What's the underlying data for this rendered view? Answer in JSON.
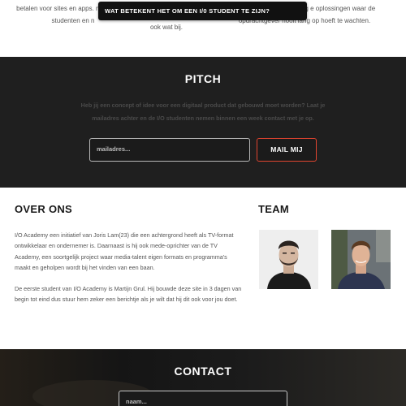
{
  "top": {
    "col1": "betalen voor sites en apps. maken voor studenten en n",
    "col2": "ook wat bij.",
    "col3": "er het product. Het gevolg e oplossingen waar de opdrachtgever nooit lang op hoeft te wachten.",
    "tooltip": "WAT BETEKENT HET OM EEN I/0 STUDENT TE ZIJN?"
  },
  "pitch": {
    "title": "PITCH",
    "description": "Heb jij een concept of idee voor een digitaal product dat gebouwd moet worden? Laat je mailadres achter en de I/O studenten nemen binnen een week contact met je op.",
    "email_placeholder": "mailadres...",
    "button_label": "MAIL MIJ"
  },
  "about": {
    "title": "OVER ONS",
    "paragraph1": "I/O Academy een initiatief van Joris Lam(23) die een achtergrond heeft als TV-format ontwikkelaar en ondernemer is. Daarnaast is hij ook mede-oprichter van de TV Academy, een soortgelijk project waar media-talent eigen formats en programma's maakt en geholpen wordt bij het vinden van een baan.",
    "paragraph2": "De eerste student van I/O Academy is Martijn Grul. Hij bouwde deze site in 3 dagen van begin tot eind dus stuur hem zeker een berichtje als je wilt dat hij dit ook voor jou doet."
  },
  "team": {
    "title": "TEAM"
  },
  "contact": {
    "title": "CONTACT",
    "name_placeholder": "naam..."
  },
  "colors": {
    "dark_bg": "#1f1f1f",
    "accent": "#e0442f"
  }
}
